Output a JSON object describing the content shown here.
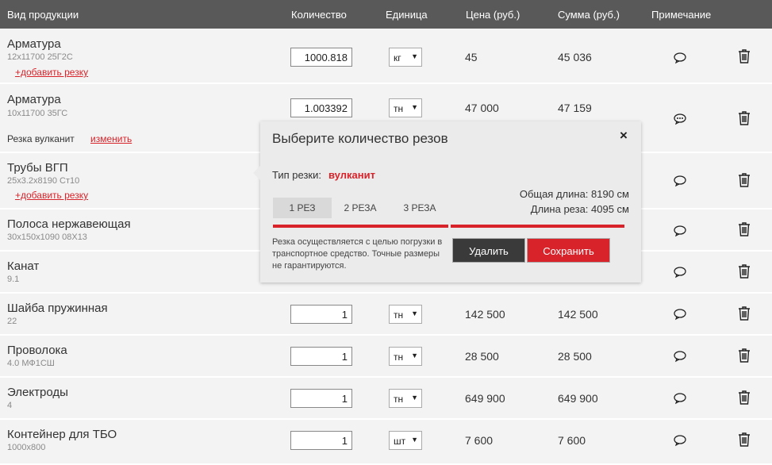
{
  "header": {
    "col_product": "Вид продукции",
    "col_quantity": "Количество",
    "col_unit": "Единица",
    "col_price": "Цена (руб.)",
    "col_sum": "Сумма (руб.)",
    "col_note": "Примечание"
  },
  "rows": [
    {
      "name": "Арматура",
      "sub": "12x11700 25Г2С",
      "add_cut": "+добавить резку",
      "quantity": "1000.818",
      "unit": "кг",
      "price": "45",
      "sum": "45 036"
    },
    {
      "name": "Арматура",
      "sub": "10x11700 35ГС",
      "cut_info": "Резка вулканит",
      "cut_change": "изменить",
      "quantity": "1.003392",
      "unit": "тн",
      "price": "47 000",
      "sum": "47 159"
    },
    {
      "name": "Трубы ВГП",
      "sub": "25x3.2x8190 Ст10",
      "add_cut": "+добавить резку"
    },
    {
      "name": "Полоса нержавеющая",
      "sub": "30x150x1090 08Х13"
    },
    {
      "name": "Канат",
      "sub": "9.1"
    },
    {
      "name": "Шайба пружинная",
      "sub": "22",
      "quantity": "1",
      "unit": "тн",
      "price": "142 500",
      "sum": "142 500"
    },
    {
      "name": "Проволока",
      "sub": "4.0 МФ1СШ",
      "quantity": "1",
      "unit": "тн",
      "price": "28 500",
      "sum": "28 500"
    },
    {
      "name": "Электроды",
      "sub": "4",
      "quantity": "1",
      "unit": "тн",
      "price": "649 900",
      "sum": "649 900"
    },
    {
      "name": "Контейнер для ТБО",
      "sub": "1000x800",
      "quantity": "1",
      "unit": "шт",
      "price": "7 600",
      "sum": "7 600"
    }
  ],
  "popup": {
    "title": "Выберите количество резов",
    "close": "×",
    "type_label": "Тип резки:",
    "type_value": "вулканит",
    "tabs": [
      "1 РЕЗ",
      "2 РЕЗА",
      "3 РЕЗА"
    ],
    "total_length": "Общая длина: 8190 см",
    "cut_length": "Длина реза: 4095 см",
    "info": "Резка осуществляется с целью погрузки в транспортное средство. Точные размеры не гарантируются.",
    "delete_label": "Удалить",
    "save_label": "Сохранить"
  },
  "icons": {
    "note": "speech-bubble-icon",
    "trash": "trash-icon"
  },
  "colors": {
    "accent": "#d9232a",
    "header_bg": "#595959",
    "row_bg": "#f3f3f3",
    "delete_btn": "#3a3a3a"
  }
}
